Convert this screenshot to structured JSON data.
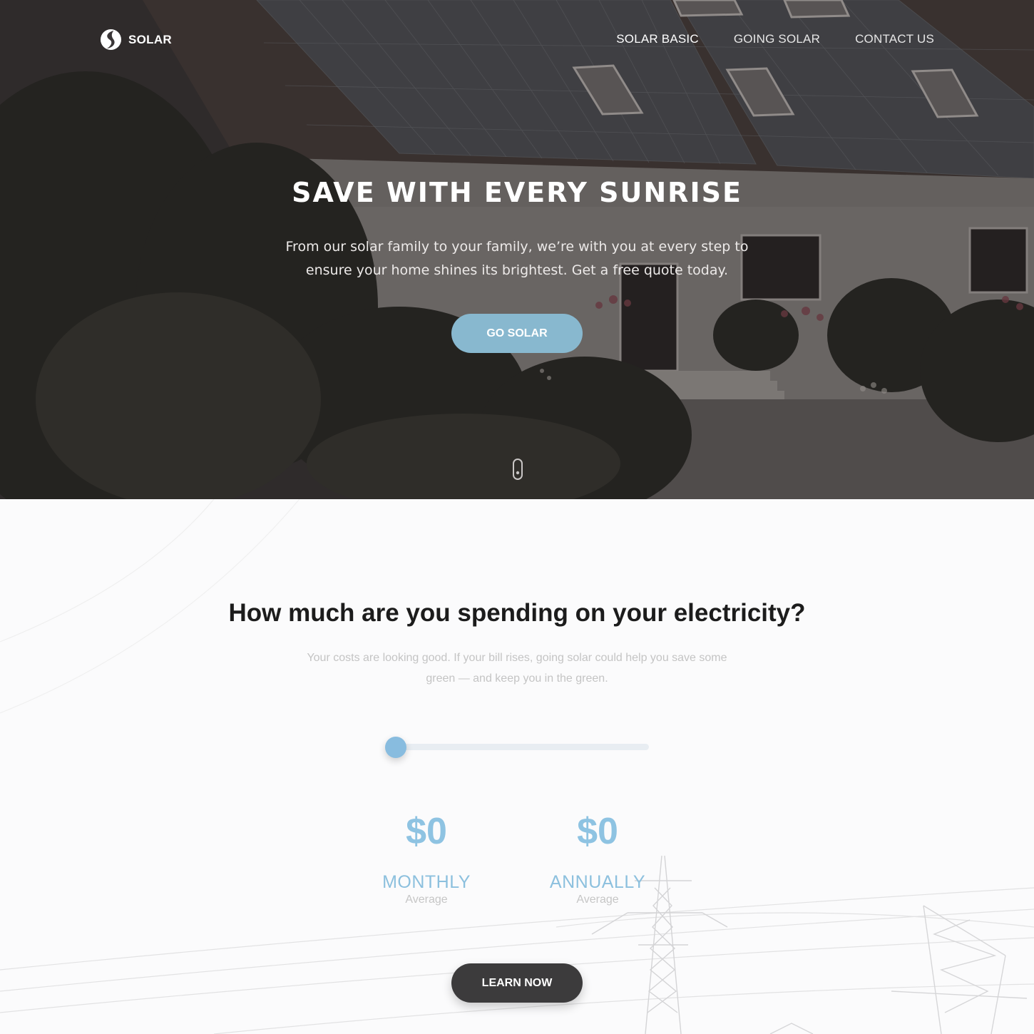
{
  "brand": {
    "name": "SOLAR"
  },
  "nav": {
    "items": [
      {
        "label": "SOLAR BASIC",
        "active": true
      },
      {
        "label": "GOING SOLAR",
        "active": false
      },
      {
        "label": "CONTACT US",
        "active": false
      }
    ]
  },
  "hero": {
    "title": "SAVE WITH EVERY SUNRISE",
    "subtitle": "From our solar family to your family, we’re with you at every step to ensure your home shines its brightest. Get a free quote today.",
    "cta_label": "GO SOLAR",
    "scroll_icon": "mouse-scroll-icon"
  },
  "calculator": {
    "title": "How much are you spending on your electricity?",
    "subtitle": "Your costs are looking good. If your bill rises, going solar could help you save some green — and keep you in the green.",
    "slider_value": 0,
    "monthly": {
      "value": "$0",
      "label": "MONTHLY",
      "note": "Average"
    },
    "annually": {
      "value": "$0",
      "label": "ANNUALLY",
      "note": "Average"
    },
    "cta_label": "LEARN NOW"
  },
  "colors": {
    "accent_blue": "#88b8cf",
    "stat_blue": "#8ec3e2",
    "dark_button": "#3c3b3c"
  }
}
